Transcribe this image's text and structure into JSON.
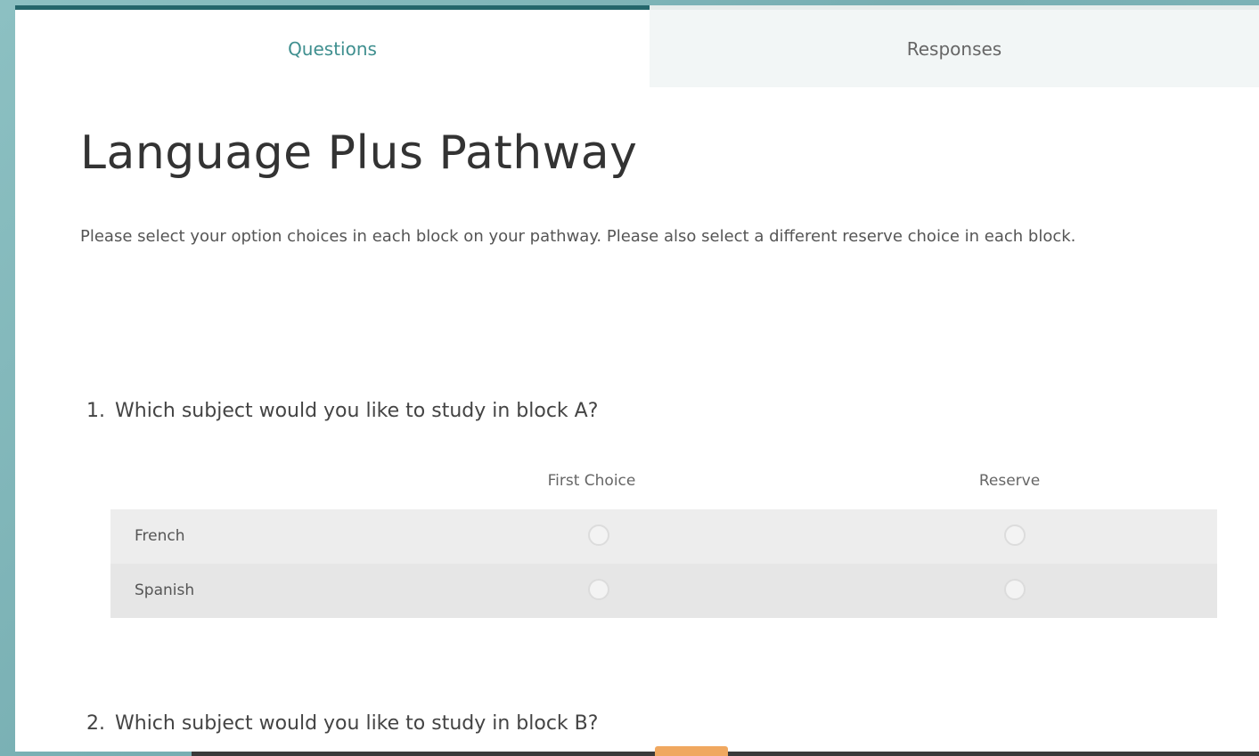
{
  "tabs": {
    "questions": "Questions",
    "responses": "Responses"
  },
  "form": {
    "title": "Language Plus Pathway",
    "description": "Please select your option choices in each block on your pathway. Please also select a different reserve choice in each block."
  },
  "questions": [
    {
      "number": "1.",
      "text": "Which subject would you like to study in block A?",
      "columns": [
        "First Choice",
        "Reserve"
      ],
      "rows": [
        {
          "label": "French",
          "first_selected": false,
          "reserve_selected": false
        },
        {
          "label": "Spanish",
          "first_selected": false,
          "reserve_selected": false
        }
      ]
    },
    {
      "number": "2.",
      "text": "Which subject would you like to study in block B?"
    }
  ],
  "colors": {
    "accent": "#24666b",
    "tab_active_text": "#3f8f8f",
    "background": "#7fb6b9"
  }
}
